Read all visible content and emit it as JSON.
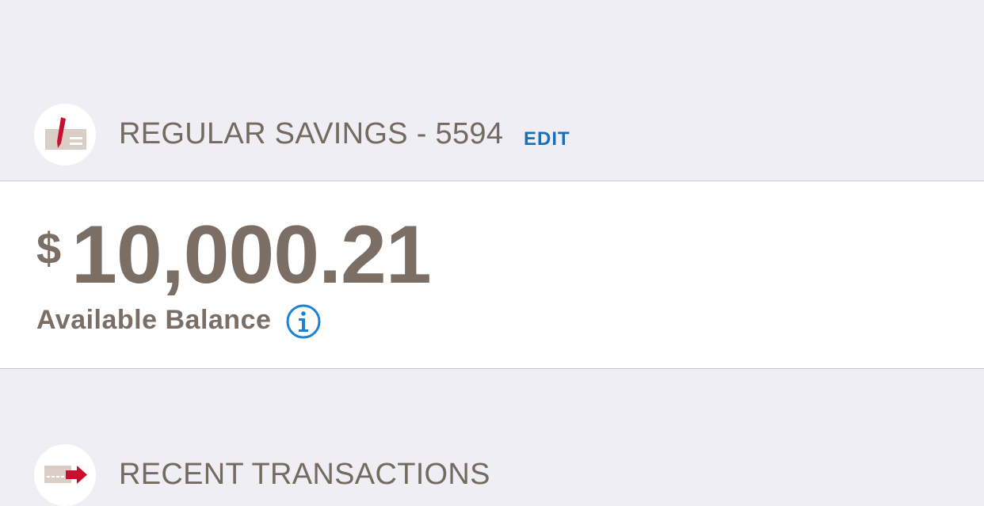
{
  "account": {
    "title": "REGULAR SAVINGS - 5594",
    "edit_label": "EDIT",
    "icon": "check-pen-icon"
  },
  "balance": {
    "currency_symbol": "$",
    "amount": "10,000.21",
    "label": "Available Balance",
    "info_icon": "info-icon"
  },
  "transactions": {
    "title": "RECENT TRANSACTIONS",
    "icon": "transfer-arrow-icon"
  },
  "colors": {
    "background": "#efeef4",
    "text": "#7b6f65",
    "link": "#1b6fb3",
    "info": "#1e82d4",
    "icon_accent": "#c8102e"
  }
}
